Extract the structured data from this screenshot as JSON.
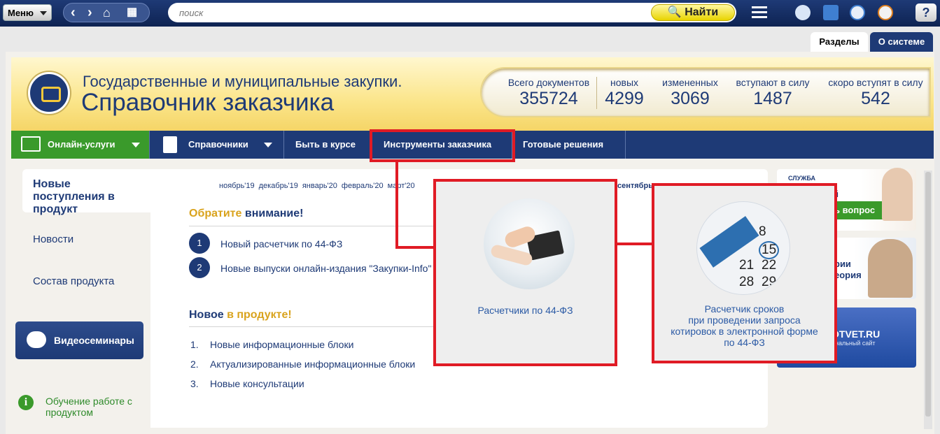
{
  "topbar": {
    "menu_label": "Меню",
    "search_placeholder": "поиск",
    "find_label": "Найти"
  },
  "tabs": [
    "Разделы",
    "О системе"
  ],
  "header": {
    "title_line1": "Государственные и муниципальные закупки.",
    "title_line2": "Справочник заказчика"
  },
  "stats": [
    {
      "label": "Всего документов",
      "value": "355724"
    },
    {
      "label": "новых",
      "value": "4299"
    },
    {
      "label": "измененных",
      "value": "3069"
    },
    {
      "label": "вступают в силу",
      "value": "1487"
    },
    {
      "label": "скоро вступят в силу",
      "value": "542"
    }
  ],
  "navbar": {
    "online": "Онлайн-услуги",
    "directories": "Справочники",
    "news": "Быть в курсе",
    "tools": "Инструменты заказчика",
    "solutions": "Готовые решения"
  },
  "leftnav": {
    "active": "Новые поступления в продукт",
    "items": [
      "Новости",
      "Состав продукта"
    ],
    "video": "Видеосеминары",
    "learn": "Обучение работе с продуктом"
  },
  "months": [
    "ноябрь'19",
    "декабрь'19",
    "январь'20",
    "февраль'20",
    "март'20",
    "сентябрь"
  ],
  "attention": {
    "title_a": "Обратите",
    "title_b": " внимание!",
    "items": [
      {
        "num": "1",
        "text": "Новый расчетчик по 44-ФЗ"
      },
      {
        "num": "2",
        "text": "Новые выпуски онлайн-издания \"Закупки-Info\""
      }
    ]
  },
  "newin": {
    "title_a": "Новое",
    "title_b": " в продукте!",
    "items": [
      {
        "num": "1.",
        "text": "Новые информационные блоки"
      },
      {
        "num": "2.",
        "text": "Актуализированные информационные блоки"
      },
      {
        "num": "3.",
        "text": "Новые консультации"
      }
    ]
  },
  "popups": {
    "calc": "Расчетчики по 44-ФЗ",
    "terms": [
      "Расчетчик сроков",
      "при проведении запроса",
      "котировок в электронной форме",
      "по 44-ФЗ"
    ]
  },
  "calendar_numbers": [
    "8",
    "15",
    "21",
    "22",
    "28",
    "29"
  ],
  "side": {
    "service": "СЛУЖБА",
    "frag1": "й",
    "question": "ь вопрос",
    "frag2": "рии",
    "frag3": "еория",
    "site": "OTVET.RU",
    "site_sub": "ональный сайт"
  },
  "colors": {
    "navy": "#1e3a76",
    "green": "#3a9a2b",
    "red": "#e01b25",
    "yellow": "#e8d400"
  }
}
